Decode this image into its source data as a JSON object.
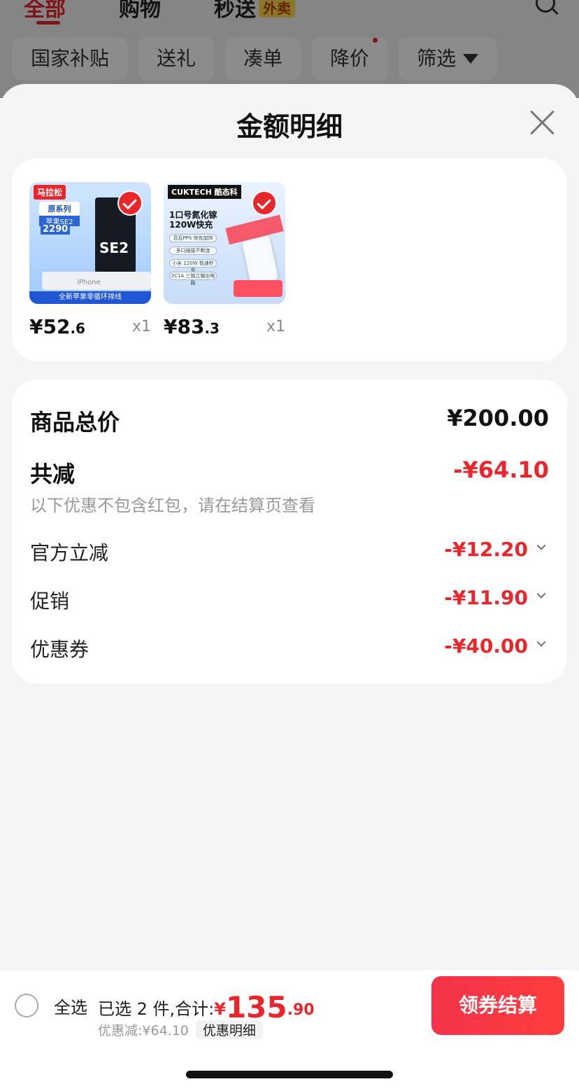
{
  "background": {
    "tabs": [
      {
        "label": "全部",
        "active": true
      },
      {
        "label": "购物",
        "active": false
      },
      {
        "label": "秒送",
        "active": false,
        "badge": "外卖"
      }
    ],
    "chips": [
      "国家补贴",
      "送礼",
      "凑单",
      "降价",
      "筛选"
    ]
  },
  "sheet": {
    "title": "金额明细"
  },
  "products": [
    {
      "price_int": "¥52",
      "price_dec": ".6",
      "qty": "x1",
      "art": {
        "logo": "马拉松",
        "label": "原系列",
        "sub": "苹果SE2",
        "num": "2290",
        "batt": "SE2",
        "base": "iPhone",
        "foot": "全新苹果零循环排线"
      }
    },
    {
      "price_int": "¥83",
      "price_dec": ".3",
      "qty": "x1",
      "art": {
        "logo": "CUKTECH 酷态科",
        "title": "1口号氮化镓\n120W快充",
        "lines": [
          "百瓦PPS 快充加持",
          "多口插拔不断连",
          "小米 120W 极速秒充",
          "2C1A 三独立输出电路"
        ]
      }
    }
  ],
  "summary": {
    "total_label": "商品总价",
    "total_value": "¥200.00",
    "reduce_label": "共减",
    "reduce_value": "-¥64.10",
    "note": "以下优惠不包含红包，请在结算页查看",
    "details": [
      {
        "label": "官方立减",
        "value": "-¥12.20"
      },
      {
        "label": "促销",
        "value": "-¥11.90"
      },
      {
        "label": "优惠券",
        "value": "-¥40.00"
      }
    ]
  },
  "bottom": {
    "select_all": "全选",
    "selected_text": "已选 2 件,合计:",
    "currency": "¥",
    "sum_int": "135",
    "sum_dec": ".90",
    "discount_text": "优惠减:¥64.10",
    "discount_detail": "优惠明细",
    "checkout": "领券结算"
  },
  "colors": {
    "accent": "#e8262b",
    "background": "#f5f5f5"
  }
}
